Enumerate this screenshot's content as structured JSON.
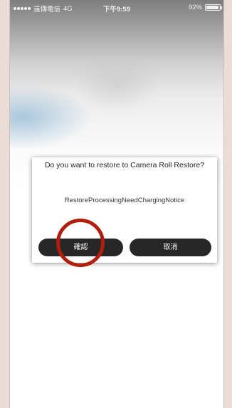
{
  "status_bar": {
    "carrier": "遠傳電信",
    "network": "4G",
    "time": "下午9:59",
    "battery": "92%",
    "battery_level": 0.92
  },
  "dialog": {
    "title": "Do you want to restore to Camera Roll Restore?",
    "message": "RestoreProcessingNeedChargingNotice",
    "confirm_label": "確認",
    "cancel_label": "取消"
  },
  "annotation": {
    "color": "#b11e0d"
  }
}
